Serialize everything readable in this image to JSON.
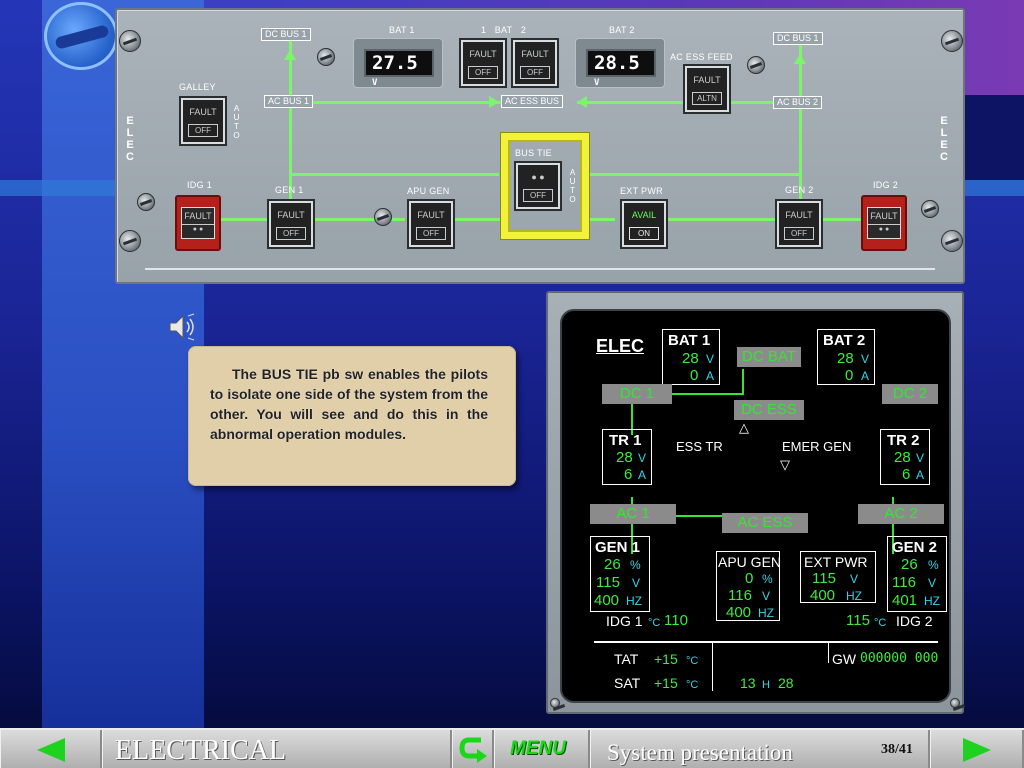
{
  "panel": {
    "side_label": "ELEC",
    "auto": "AUTO",
    "galley": {
      "label": "GALLEY",
      "top": "FAULT",
      "bottom": "OFF"
    },
    "bat": {
      "bat1_label": "BAT 1",
      "bat1_value": "27.5",
      "unit": "V",
      "bat2_label": "BAT 2",
      "bat2_value": "28.5",
      "pb_label": "BAT",
      "pb_1": "1",
      "pb_2": "2",
      "pb_top": "FAULT",
      "pb_bottom": "OFF"
    },
    "dc_bus1": "DC BUS 1",
    "dc_bus1_right": "DC BUS 1",
    "ac_bus1": "AC BUS 1",
    "ac_bus2": "AC BUS 2",
    "ac_ess_bus": "AC ESS BUS",
    "ac_ess_feed": {
      "label": "AC ESS FEED",
      "top": "FAULT",
      "bottom": "ALTN"
    },
    "idg1": {
      "label": "IDG 1",
      "top": "FAULT"
    },
    "idg2": {
      "label": "IDG 2",
      "top": "FAULT"
    },
    "gen1": {
      "label": "GEN 1",
      "top": "FAULT",
      "bottom": "OFF"
    },
    "gen2": {
      "label": "GEN 2",
      "top": "FAULT",
      "bottom": "OFF"
    },
    "apu_gen": {
      "label": "APU GEN",
      "top": "FAULT",
      "bottom": "OFF"
    },
    "bus_tie": {
      "label": "BUS TIE",
      "bottom": "OFF"
    },
    "ext_pwr": {
      "label": "EXT PWR",
      "top": "AVAIL",
      "bottom": "ON"
    }
  },
  "note": {
    "text": "The BUS TIE pb sw enables the pilots to isolate one side of the system from the other.  You will see and do this in the abnormal operation modules."
  },
  "ecam": {
    "title": "ELEC",
    "bat1": {
      "label": "BAT 1",
      "v": "28",
      "a": "0"
    },
    "bat2": {
      "label": "BAT 2",
      "v": "28",
      "a": "0"
    },
    "units": {
      "v": "V",
      "a": "A",
      "pct": "%",
      "hz": "HZ",
      "c": "°C",
      "h": "H"
    },
    "dc_bat": "DC BAT",
    "dc1": "DC 1",
    "dc2": "DC 2",
    "dc_ess": "DC ESS",
    "tr1": {
      "label": "TR 1",
      "v": "28",
      "a": "6"
    },
    "tr2": {
      "label": "TR 2",
      "v": "28",
      "a": "6"
    },
    "ess_tr": "ESS TR",
    "emer_gen": "EMER GEN",
    "ac1": "AC 1",
    "ac2": "AC 2",
    "ac_ess": "AC ESS",
    "gen1": {
      "label": "GEN 1",
      "pct": "26",
      "v": "115",
      "hz": "400"
    },
    "gen2": {
      "label": "GEN 2",
      "pct": "26",
      "v": "116",
      "hz": "401"
    },
    "apu_gen": {
      "label": "APU GEN",
      "pct": "0",
      "v": "116",
      "hz": "400"
    },
    "ext_pwr": {
      "label": "EXT PWR",
      "v": "115",
      "hz": "400"
    },
    "idg1": {
      "label": "IDG 1",
      "temp": "110"
    },
    "idg2": {
      "label": "IDG 2",
      "temp": "115"
    },
    "tat": {
      "label": "TAT",
      "value": "+15"
    },
    "sat": {
      "label": "SAT",
      "value": "+15"
    },
    "time": {
      "h": "13",
      "m": "28"
    },
    "gw": {
      "label": "GW",
      "value": "000000 000"
    }
  },
  "footer": {
    "section": "ELECTRICAL",
    "menu": "MENU",
    "subtitle": "System presentation",
    "page": "38/41",
    "colors": {
      "arrow": "#1fd21f",
      "menu": "#1ad818"
    }
  }
}
